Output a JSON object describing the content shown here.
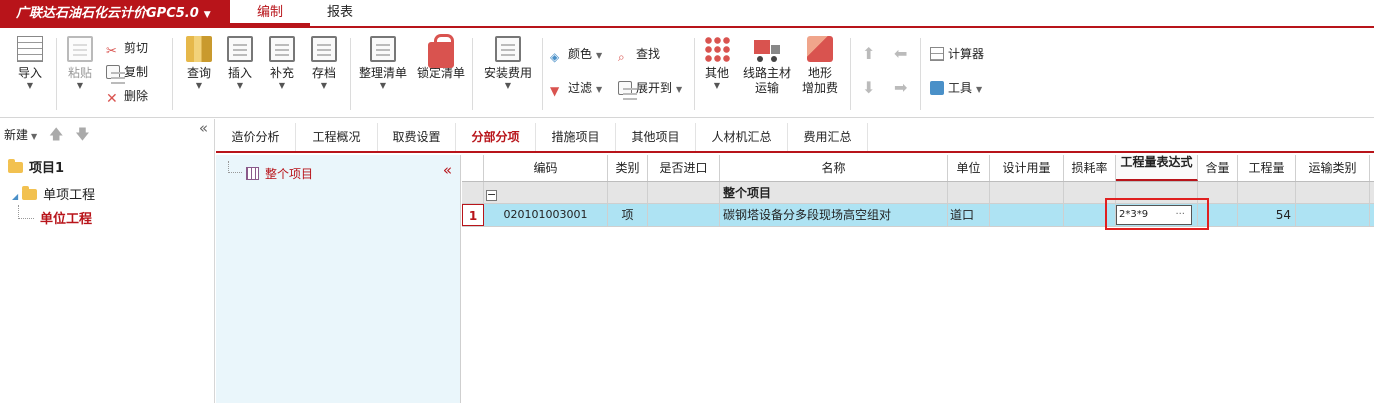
{
  "app": {
    "brand": "广联达石油石化云计价GPC5.0",
    "menu_tabs": [
      "编制",
      "报表"
    ]
  },
  "ribbon": {
    "import": "导入",
    "paste": "粘贴",
    "cut": "剪切",
    "copy": "复制",
    "delete": "删除",
    "query": "查询",
    "insert": "插入",
    "supplement": "补充",
    "archive": "存档",
    "organize": "整理清单",
    "lock": "锁定清单",
    "install_fee": "安装费用",
    "color": "颜色",
    "find": "查找",
    "filter": "过滤",
    "expand": "展开到",
    "other": "其他",
    "route_line1": "线路主材",
    "route_line2": "运输",
    "terrain_line1": "地形",
    "terrain_line2": "增加费",
    "calculator": "计算器",
    "tools": "工具"
  },
  "left_tree": {
    "new_label": "新建",
    "project": "项目1",
    "single": "单项工程",
    "unit": "单位工程"
  },
  "tabs": [
    "造价分析",
    "工程概况",
    "取费设置",
    "分部分项",
    "措施项目",
    "其他项目",
    "人材机汇总",
    "费用汇总"
  ],
  "subtree": {
    "item": "整个项目"
  },
  "grid": {
    "headers": {
      "code": "编码",
      "type": "类别",
      "imported": "是否进口",
      "name": "名称",
      "unit": "单位",
      "design_qty": "设计用量",
      "loss_rate": "损耗率",
      "expr": "工程量表达式",
      "content": "含量",
      "qty": "工程量",
      "transport": "运输类别"
    },
    "group_row": {
      "name": "整个项目"
    },
    "row1": {
      "num": "1",
      "code": "020101003001",
      "type": "项",
      "name": "碳钢塔设备分多段现场高空组对",
      "unit": "道口",
      "expr": "2*3*9",
      "expr_btn": "···",
      "qty": "54"
    }
  },
  "colors": {
    "accent": "#b8141a",
    "row_selected": "#aee3f3",
    "subpane_bg": "#eaf6fb",
    "highlight_box": "#e02020"
  }
}
